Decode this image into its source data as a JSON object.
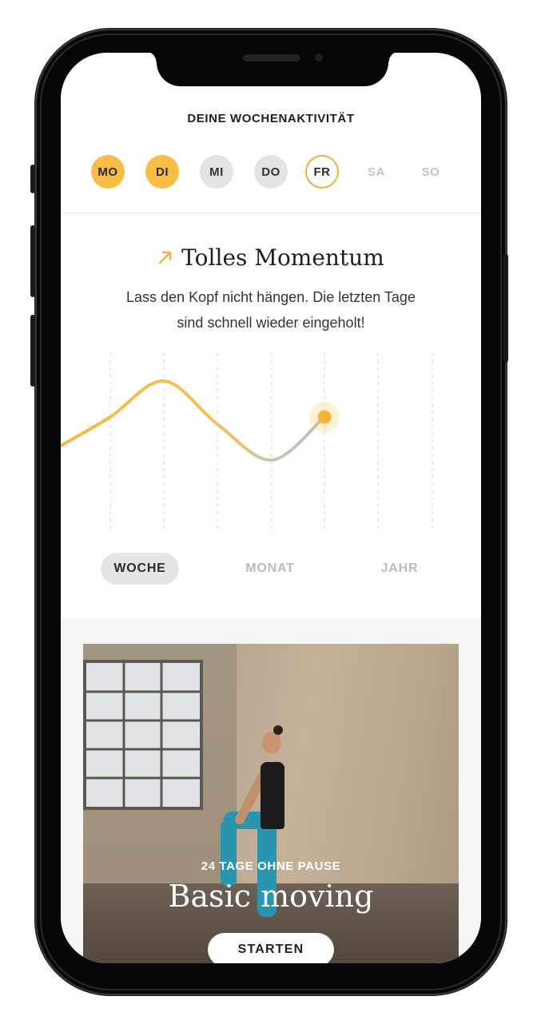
{
  "colors": {
    "accent": "#f9bd45",
    "accent_border": "#f0b13a",
    "curve_gray": "#bdbdbd",
    "muted": "#c3c3c3",
    "pill": "#e3e3e3",
    "card_button": "#ffffff"
  },
  "week": {
    "title": "DEINE WOCHENAKTIVITÄT",
    "days": [
      {
        "label": "MO",
        "state": "done"
      },
      {
        "label": "DI",
        "state": "done"
      },
      {
        "label": "MI",
        "state": "missed"
      },
      {
        "label": "DO",
        "state": "missed"
      },
      {
        "label": "FR",
        "state": "today"
      },
      {
        "label": "SA",
        "state": "future"
      },
      {
        "label": "SO",
        "state": "future"
      }
    ]
  },
  "momentum": {
    "icon": "arrow-up-right-icon",
    "title": "Tolles Momentum",
    "subtitle_line1": "Lass den Kopf nicht hängen. Die letzten Tage",
    "subtitle_line2": "sind schnell wieder eingeholt!"
  },
  "chart_data": {
    "type": "line",
    "x": [
      "",
      "MO",
      "DI",
      "MI",
      "DO",
      "FR",
      "SA",
      "SO"
    ],
    "series": [
      {
        "values": [
          0.4,
          0.6,
          0.85,
          0.55,
          0.3,
          0.6
        ]
      }
    ],
    "current_point_index": 5,
    "grid": "vertical-dashed",
    "ylim": [
      0,
      1
    ]
  },
  "tabs": {
    "items": [
      {
        "label": "WOCHE",
        "active": true
      },
      {
        "label": "MONAT",
        "active": false
      },
      {
        "label": "JAHR",
        "active": false
      }
    ]
  },
  "card": {
    "subtitle": "24 TAGE OHNE PAUSE",
    "title": "Basic moving",
    "button_label": "STARTEN"
  }
}
